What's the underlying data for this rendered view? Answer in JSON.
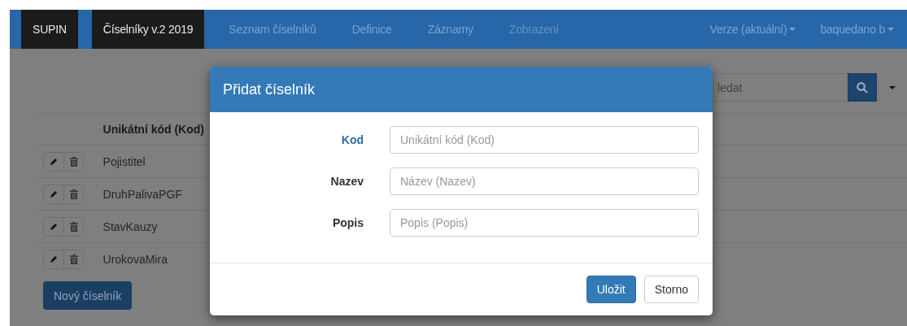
{
  "navbar": {
    "brand": "SUPIN",
    "items": [
      {
        "label": "Číselníky v.2 2019",
        "selected": true,
        "disabled": false
      },
      {
        "label": "Seznam číselníků",
        "selected": false,
        "disabled": false
      },
      {
        "label": "Definice",
        "selected": false,
        "disabled": false
      },
      {
        "label": "Záznamy",
        "selected": false,
        "disabled": false
      },
      {
        "label": "Zobrazení",
        "selected": false,
        "disabled": true
      }
    ],
    "menus": [
      {
        "label": "Verze (aktuální)"
      },
      {
        "label": "baquedano b"
      }
    ]
  },
  "search": {
    "placeholder": "ledat"
  },
  "table": {
    "columns": [
      {
        "label": "Unikátní kód (Kod)"
      }
    ],
    "rows": [
      {
        "kod": "Pojistitel"
      },
      {
        "kod": "DruhPalivaPGF"
      },
      {
        "kod": "StavKauzy"
      },
      {
        "kod": "UrokovaMira"
      }
    ]
  },
  "new_button": "Nový číselník",
  "modal": {
    "title": "Přidat číselník",
    "fields": [
      {
        "label": "Kod",
        "placeholder": "Unikátní kód (Kod)",
        "highlighted": true
      },
      {
        "label": "Nazev",
        "placeholder": "Název (Nazev)",
        "highlighted": false
      },
      {
        "label": "Popis",
        "placeholder": "Popis (Popis)",
        "highlighted": false
      }
    ],
    "buttons": [
      {
        "label": "Uložit",
        "kind": "primary"
      },
      {
        "label": "Storno",
        "kind": "default"
      }
    ]
  }
}
